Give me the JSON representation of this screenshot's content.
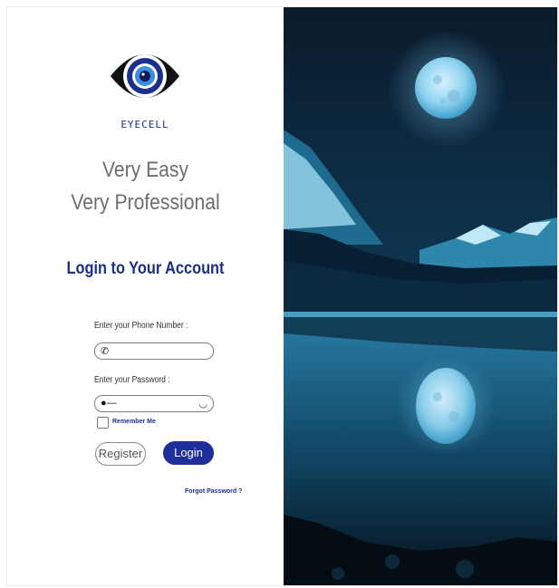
{
  "brand": {
    "name": "EYECELL"
  },
  "tagline": {
    "line1": "Very Easy",
    "line2": "Very Professional"
  },
  "login": {
    "title": "Login to Your Account",
    "phone_label": "Enter your Phone Number :",
    "phone_value": "",
    "password_label": "Enter your Password  :",
    "password_value": "",
    "remember_label": "Remember Me",
    "remember_checked": false,
    "register_button": "Register",
    "login_button": "Login",
    "forgot_link": "Forgot Password ?"
  },
  "icons": {
    "phone": "phone-icon",
    "key": "key-icon",
    "eye": "eye-closed-icon",
    "logo": "eye-logo-icon"
  },
  "colors": {
    "brand_blue": "#1b2f8c",
    "login_button": "#1f2f9a",
    "tagline_gray": "#6e6e6e"
  }
}
